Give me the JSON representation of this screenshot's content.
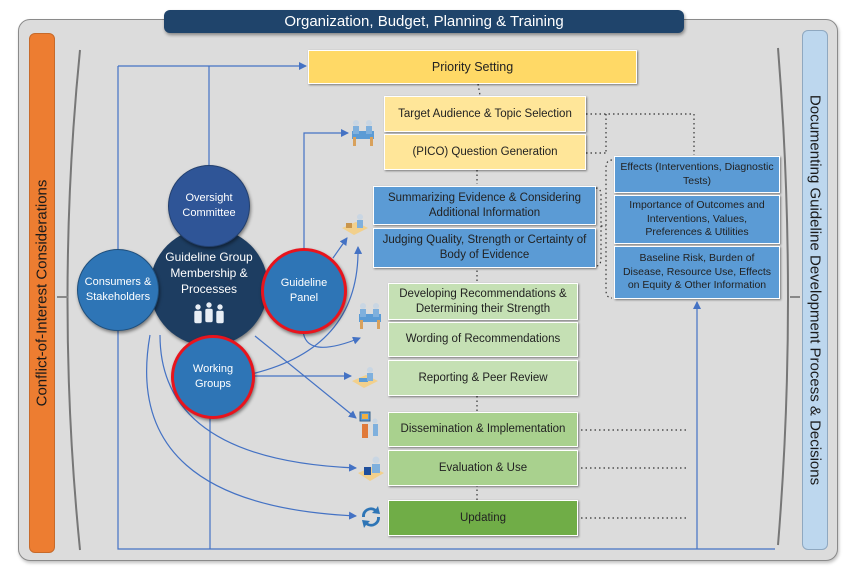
{
  "header": {
    "title": "Organization, Budget, Planning & Training"
  },
  "side_panels": {
    "left": "Conflict-of-Interest Considerations",
    "right": "Documenting Guideline Development Process & Decisions"
  },
  "colors": {
    "header_bg": "#1f446b",
    "left_panel": "#ed7d31",
    "right_panel": "#bdd7ee",
    "arrows": "#4472c4",
    "red_ring": "#e8141d"
  },
  "circles": {
    "center": "Guideline Group Membership & Processes",
    "center_icon": "group-of-people",
    "oversight": "Oversight Committee",
    "consumers": "Consumers & Stakeholders",
    "panel": "Guideline Panel",
    "working": "Working Groups"
  },
  "steps": [
    {
      "label": "Priority Setting",
      "color": "#ffd966"
    },
    {
      "label": "Target Audience & Topic Selection",
      "color": "#ffe699"
    },
    {
      "label": "(PICO) Question Generation",
      "color": "#ffe699"
    },
    {
      "label": "Summarizing Evidence & Considering Additional Information",
      "color": "#5b9bd5"
    },
    {
      "label": "Judging Quality, Strength or Certainty of Body of Evidence",
      "color": "#5b9bd5"
    },
    {
      "label": "Developing Recommendations & Determining their Strength",
      "color": "#c5e0b4"
    },
    {
      "label": "Wording of Recommendations",
      "color": "#c5e0b4"
    },
    {
      "label": "Reporting & Peer Review",
      "color": "#c5e0b4"
    },
    {
      "label": "Dissemination & Implementation",
      "color": "#a9d18e"
    },
    {
      "label": "Evaluation & Use",
      "color": "#a9d18e"
    },
    {
      "label": "Updating",
      "color": "#70ad47"
    }
  ],
  "considerations": [
    "Effects (Interventions, Diagnostic Tests)",
    "Importance of Outcomes and Interventions, Values, Preferences & Utilities",
    "Baseline Risk, Burden of Disease, Resource Use, Effects on Equity & Other Information"
  ]
}
